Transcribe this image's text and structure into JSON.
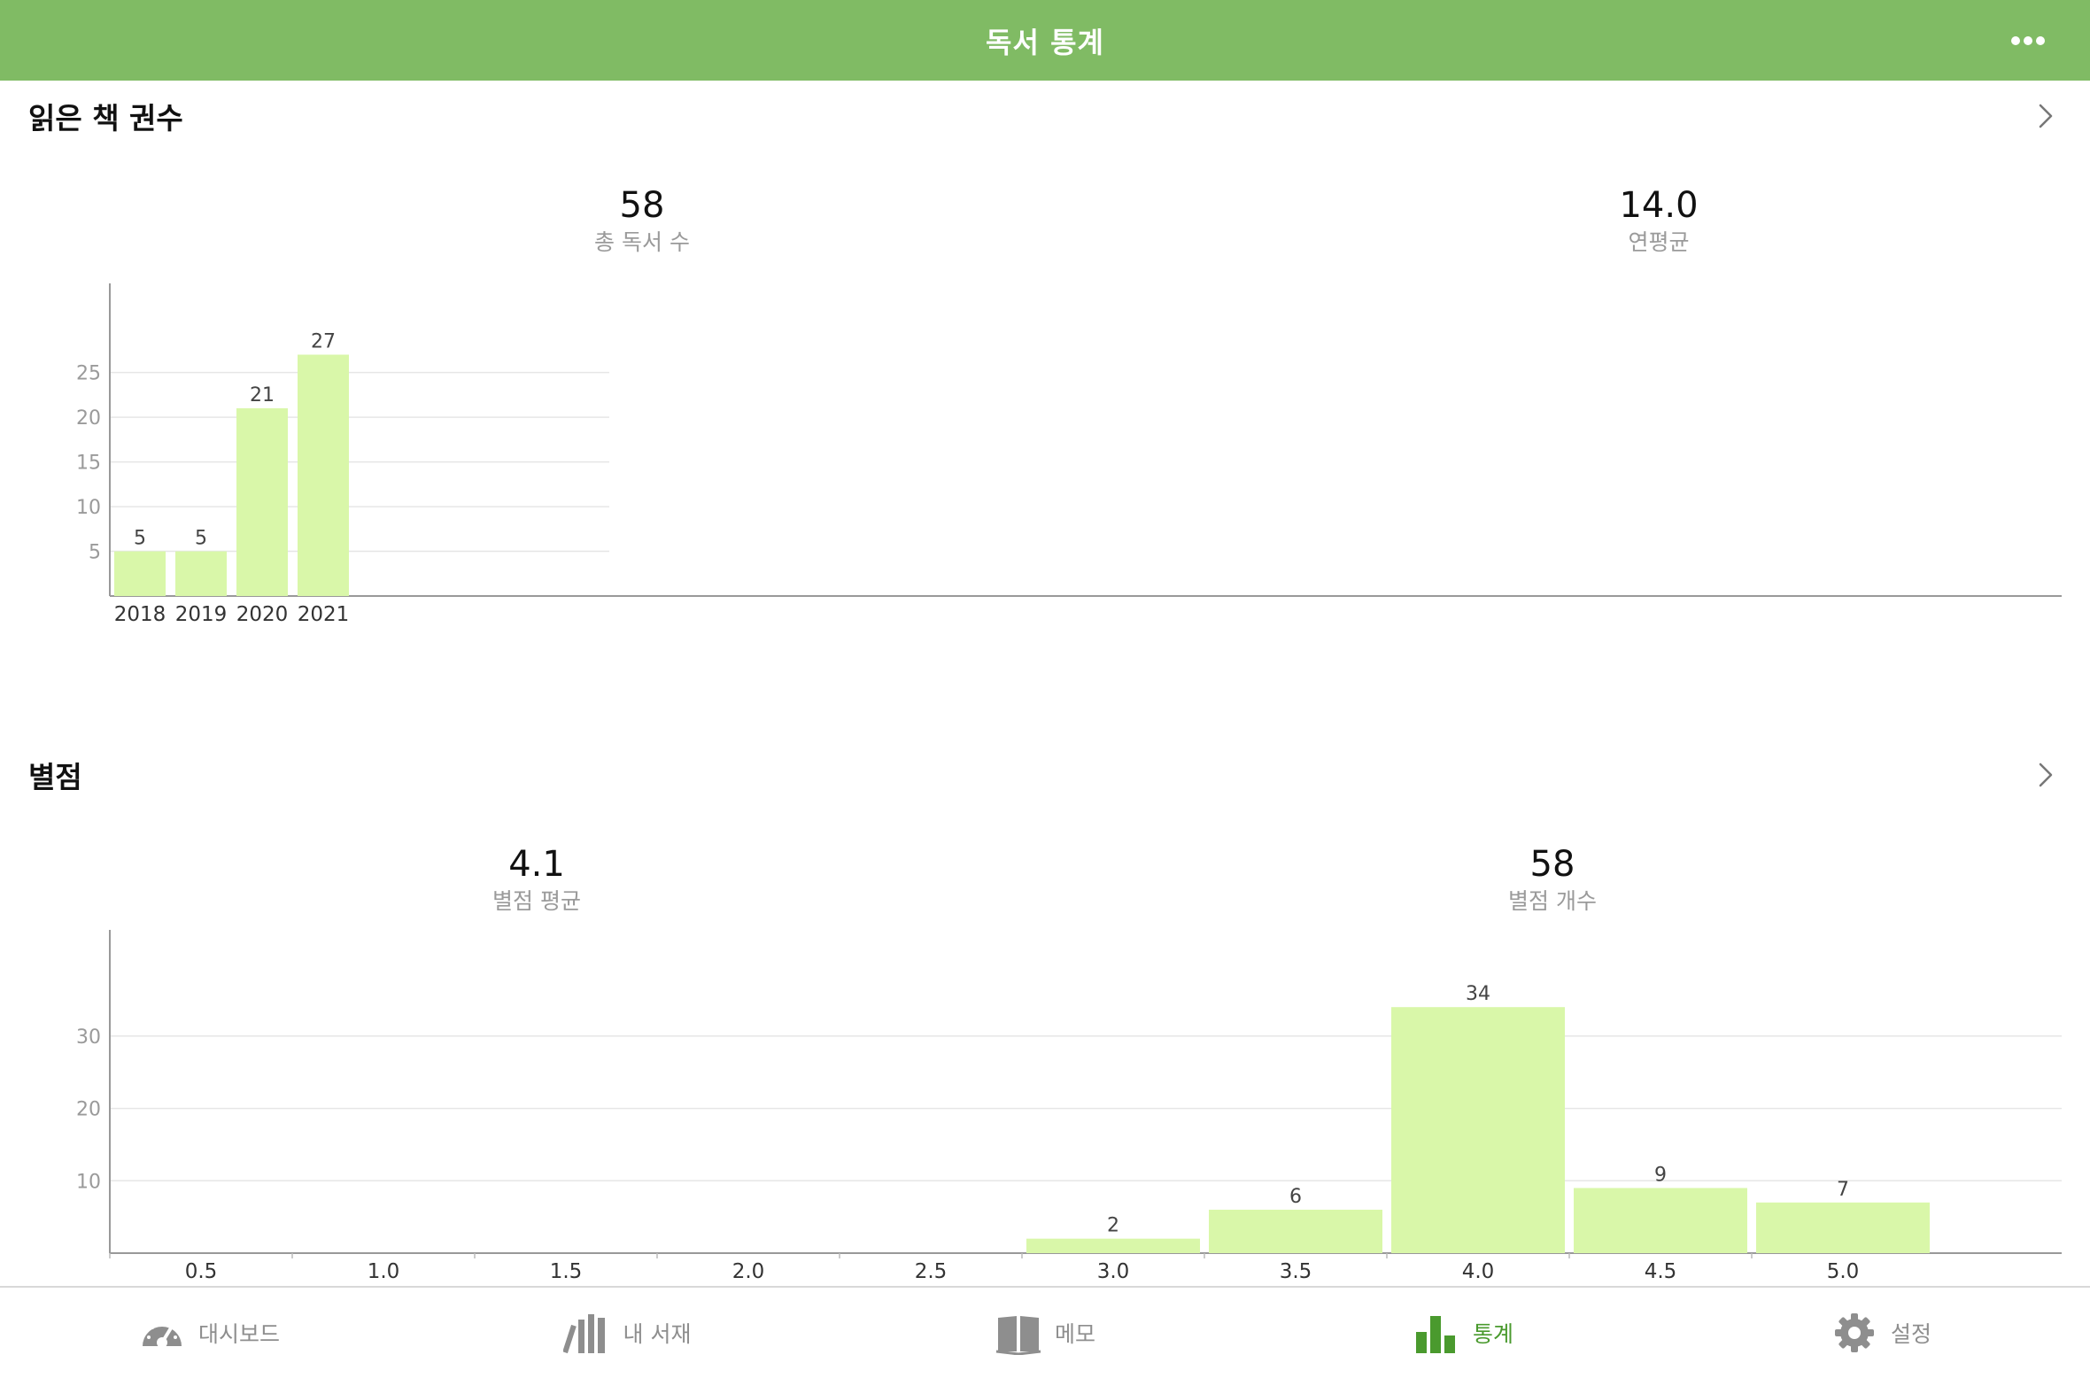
{
  "header": {
    "title": "독서 통계",
    "more_icon": "ellipsis-icon"
  },
  "sections": {
    "books": {
      "title": "읽은 책 권수",
      "stats": [
        {
          "value": "58",
          "label": "총 독서 수"
        },
        {
          "value": "14.0",
          "label": "연평균"
        }
      ]
    },
    "rating": {
      "title": "별점",
      "stats": [
        {
          "value": "4.1",
          "label": "별점 평균"
        },
        {
          "value": "58",
          "label": "별점 개수"
        }
      ]
    }
  },
  "chart_data": [
    {
      "type": "bar",
      "categories": [
        "2018",
        "2019",
        "2020",
        "2021"
      ],
      "values": [
        5,
        5,
        21,
        27
      ],
      "yticks": [
        5,
        10,
        15,
        20,
        25
      ],
      "ylim": [
        0,
        32
      ],
      "grid": true
    },
    {
      "type": "bar",
      "categories": [
        "0.5",
        "1.0",
        "1.5",
        "2.0",
        "2.5",
        "3.0",
        "3.5",
        "4.0",
        "4.5",
        "5.0"
      ],
      "values": [
        0,
        0,
        0,
        0,
        0,
        2,
        6,
        34,
        9,
        7
      ],
      "yticks": [
        10,
        20,
        30
      ],
      "ylim": [
        0,
        41
      ],
      "grid": true
    }
  ],
  "colors": {
    "accent": "#80bb64",
    "bar": "#d9f7a9",
    "active_tab": "#4a9a2e"
  },
  "tabs": [
    {
      "label": "대시보드",
      "icon": "speedometer-icon",
      "active": false
    },
    {
      "label": "내 서재",
      "icon": "bookshelf-icon",
      "active": false
    },
    {
      "label": "메모",
      "icon": "open-book-icon",
      "active": false
    },
    {
      "label": "통계",
      "icon": "bar-chart-icon",
      "active": true
    },
    {
      "label": "설정",
      "icon": "gear-icon",
      "active": false
    }
  ]
}
